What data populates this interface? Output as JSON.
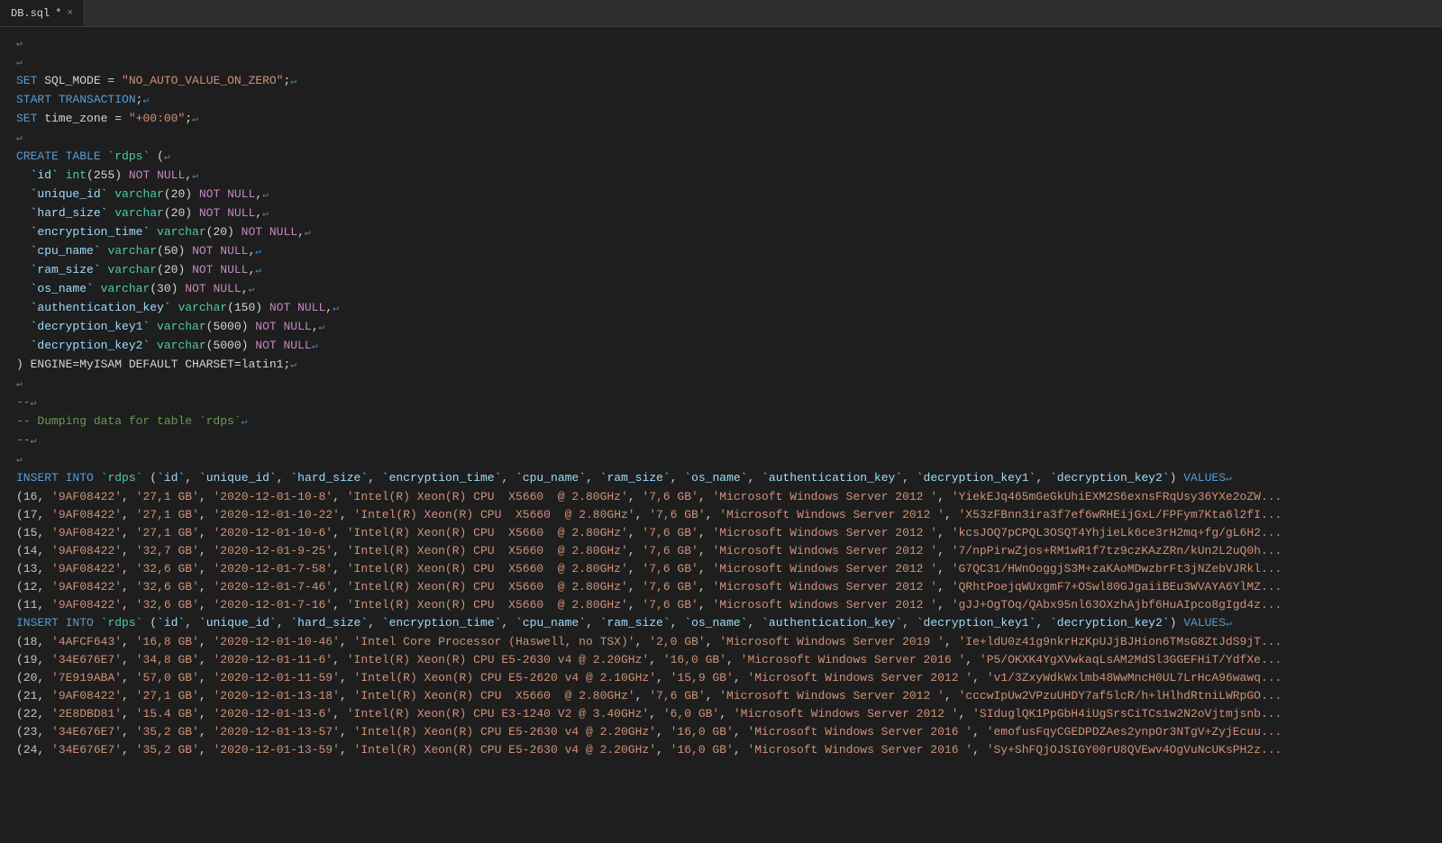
{
  "tab": {
    "label": "DB.sql",
    "modified": true,
    "close": "×"
  },
  "lines": [
    {
      "type": "newline",
      "content": ""
    },
    {
      "type": "newline",
      "content": ""
    },
    {
      "type": "code",
      "content": "SET SQL_MODE = \"NO_AUTO_VALUE_ON_ZERO\";↵"
    },
    {
      "type": "code",
      "content": "START TRANSACTION;↵"
    },
    {
      "type": "code",
      "content": "SET time_zone = \"+00:00\";↵"
    },
    {
      "type": "empty",
      "content": "↵"
    },
    {
      "type": "code",
      "content": "CREATE TABLE `rdps` (↵"
    },
    {
      "type": "code",
      "content": "  `id` int(255) NOT NULL,↵"
    },
    {
      "type": "code",
      "content": "  `unique_id` varchar(20) NOT NULL,↵"
    },
    {
      "type": "code",
      "content": "  `hard_size` varchar(20) NOT NULL,↵"
    },
    {
      "type": "code",
      "content": "  `encryption_time` varchar(20) NOT NULL,↵"
    },
    {
      "type": "code",
      "content": "  `cpu_name` varchar(50) NOT NULL,↵"
    },
    {
      "type": "code",
      "content": "  `ram_size` varchar(20) NOT NULL,↵"
    },
    {
      "type": "code",
      "content": "  `os_name` varchar(30) NOT NULL,↵"
    },
    {
      "type": "code",
      "content": "  `authentication_key` varchar(150) NOT NULL,↵"
    },
    {
      "type": "code",
      "content": "  `decryption_key1` varchar(5000) NOT NULL,↵"
    },
    {
      "type": "code",
      "content": "  `decryption_key2` varchar(5000) NOT NULL↵"
    },
    {
      "type": "code",
      "content": ") ENGINE=MyISAM DEFAULT CHARSET=latin1;↵"
    },
    {
      "type": "empty",
      "content": "↵"
    },
    {
      "type": "comment",
      "content": "--↵"
    },
    {
      "type": "comment",
      "content": "-- Dumping data for table `rdps`↵"
    },
    {
      "type": "comment",
      "content": "--↵"
    },
    {
      "type": "empty",
      "content": "↵"
    },
    {
      "type": "insert_header",
      "content": "INSERT INTO `rdps` (`id`, `unique_id`, `hard_size`, `encryption_time`, `cpu_name`, `ram_size`, `os_name`, `authentication_key`, `decryption_key1`, `decryption_key2`) VALUES↵"
    },
    {
      "type": "data",
      "id": 16,
      "content": "(16, '9AF08422', '27,1 GB', '2020-12-01-10-8', 'Intel(R) Xeon(R) CPU  X5660  @ 2.80GHz', '7,6 GB', 'Microsoft Windows Server 2012 ', 'YiekEJq465mGeGkUhiEXM2S6exnsFRqUsy36YXe2oZW"
    },
    {
      "type": "data",
      "id": 17,
      "content": "(17, '9AF08422', '27,1 GB', '2020-12-01-10-22', 'Intel(R) Xeon(R) CPU  X5660  @ 2.80GHz', '7,6 GB', 'Microsoft Windows Server 2012 ', 'X53zFBnn3ira3f7ef6wRHEijGxL/FPFym7Kta6l2fI"
    },
    {
      "type": "data",
      "id": 15,
      "content": "(15, '9AF08422', '27,1 GB', '2020-12-01-10-6', 'Intel(R) Xeon(R) CPU  X5660  @ 2.80GHz', '7,6 GB', 'Microsoft Windows Server 2012 ', 'kcsJOQ7pCPQL3OSQT4YhjieLk6ce3rH2mq+fg/gL6H2"
    },
    {
      "type": "data",
      "id": 14,
      "content": "(14, '9AF08422', '32,7 GB', '2020-12-01-9-25', 'Intel(R) Xeon(R) CPU  X5660  @ 2.80GHz', '7,6 GB', 'Microsoft Windows Server 2012 ', '7/npPirwZjos+RM1wR1f7tz9czKAzZRn/kUn2L2uQ0h"
    },
    {
      "type": "data",
      "id": 13,
      "content": "(13, '9AF08422', '32,6 GB', '2020-12-01-7-58', 'Intel(R) Xeon(R) CPU  X5660  @ 2.80GHz', '7,6 GB', 'Microsoft Windows Server 2012 ', 'G7QC31/HWnOoggjS3M+zaKAoMDwzbrFt3jNZebVJRkl"
    },
    {
      "type": "data",
      "id": 12,
      "content": "(12, '9AF08422', '32,6 GB', '2020-12-01-7-46', 'Intel(R) Xeon(R) CPU  X5660  @ 2.80GHz', '7,6 GB', 'Microsoft Windows Server 2012 ', 'QRhtPoejqWUxgmF7+OSwl80GJgaiiBEu3WVAYA6YlMZ"
    },
    {
      "type": "data",
      "id": 11,
      "content": "(11, '9AF08422', '32,6 GB', '2020-12-01-7-16', 'Intel(R) Xeon(R) CPU  X5660  @ 2.80GHz', '7,6 GB', 'Microsoft Windows Server 2012 ', 'gJJ+OgTOq/QAbx95nl63OXzhAjbf6HuAIpco8gIgd4z"
    },
    {
      "type": "insert_header2",
      "content": "INSERT INTO `rdps` (`id`, `unique_id`, `hard_size`, `encryption_time`, `cpu_name`, `ram_size`, `os_name`, `authentication_key`, `decryption_key1`, `decryption_key2`) VALUES↵"
    },
    {
      "type": "data2",
      "id": 18,
      "content": "(18, '4AFCF643', '16,8 GB', '2020-12-01-10-46', 'Intel Core Processor (Haswell, no TSX)', '2,0 GB', 'Microsoft Windows Server 2019 ', 'Ie+ldU0z41g9nkrHzKpUJjBJHion6TMsG8ZtJdS9jT"
    },
    {
      "type": "data2",
      "id": 19,
      "content": "(19, '34E676E7', '34,8 GB', '2020-12-01-11-6', 'Intel(R) Xeon(R) CPU E5-2630 v4 @ 2.20GHz', '16,0 GB', 'Microsoft Windows Server 2016 ', 'P5/OKXK4YgXVwkaqLsAM2MdSl3GGEFHiT/YdfXe"
    },
    {
      "type": "data2",
      "id": 20,
      "content": "(20, '7E919ABA', '57,0 GB', '2020-12-01-11-59', 'Intel(R) Xeon(R) CPU E5-2620 v4 @ 2.10GHz', '15,9 GB', 'Microsoft Windows Server 2012 ', 'v1/3ZxyWdkWxlmb48WwMncH0UL7LrHcA96wawq"
    },
    {
      "type": "data2",
      "id": 21,
      "content": "(21, '9AF08422', '27,1 GB', '2020-12-01-13-18', 'Intel(R) Xeon(R) CPU  X5660  @ 2.80GHz', '7,6 GB', 'Microsoft Windows Server 2012 ', 'cccwIpUw2VPzuUHDY7af5lcR/h+lHlhdRtniLWRpGO"
    },
    {
      "type": "data2",
      "id": 22,
      "content": "(22, '2E8DBD81', '15.4 GB', '2020-12-01-13-6', 'Intel(R) Xeon(R) CPU E3-1240 V2 @ 3.40GHz', '6,0 GB', 'Microsoft Windows Server 2012 ', 'SIduglQK1PpGbH4iUgSrsCiTCs1w2N2oVjtmjsnb"
    },
    {
      "type": "data2",
      "id": 23,
      "content": "(23, '34E676E7', '35,2 GB', '2020-12-01-13-57', 'Intel(R) Xeon(R) CPU E5-2630 v4 @ 2.20GHz', '16,0 GB', 'Microsoft Windows Server 2016 ', 'emofusFqyCGEDPDZAes2ynpOr3NTgV+ZyjEcuu"
    },
    {
      "type": "data2",
      "id": 24,
      "content": "(24, '34E676E7', '35,2 GB', '2020-12-01-13-59', 'Intel(R) Xeon(R) CPU E5-2630 v4 @ 2.20GHz', '16,0 GB', 'Microsoft Windows Server 2016 ', 'Sy+ShFQjOJSIGY00rU8QVEwv4OgVuNcUKsPH2z"
    }
  ]
}
